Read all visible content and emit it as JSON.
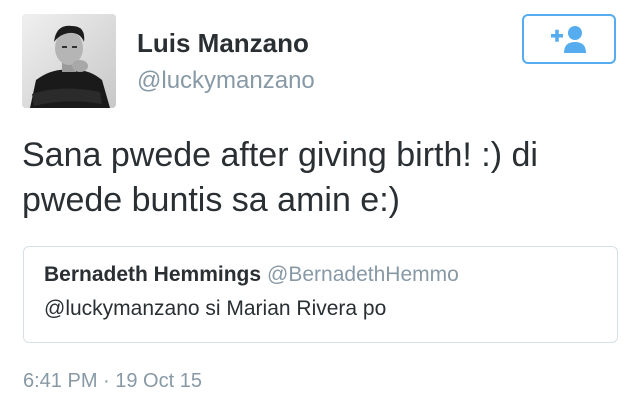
{
  "author": {
    "display_name": "Luis Manzano",
    "handle": "@luckymanzano"
  },
  "follow_button": {
    "icon": "add-user-icon",
    "accent_color": "#55acee"
  },
  "tweet": {
    "text": "Sana pwede after giving birth! :) di pwede buntis sa amin e:)"
  },
  "quoted_tweet": {
    "display_name": "Bernadeth Hemmings",
    "handle": "@BernadethHemmo",
    "text": "@luckymanzano si Marian Rivera po"
  },
  "meta": {
    "timestamp": "6:41 PM · 19 Oct 15"
  }
}
